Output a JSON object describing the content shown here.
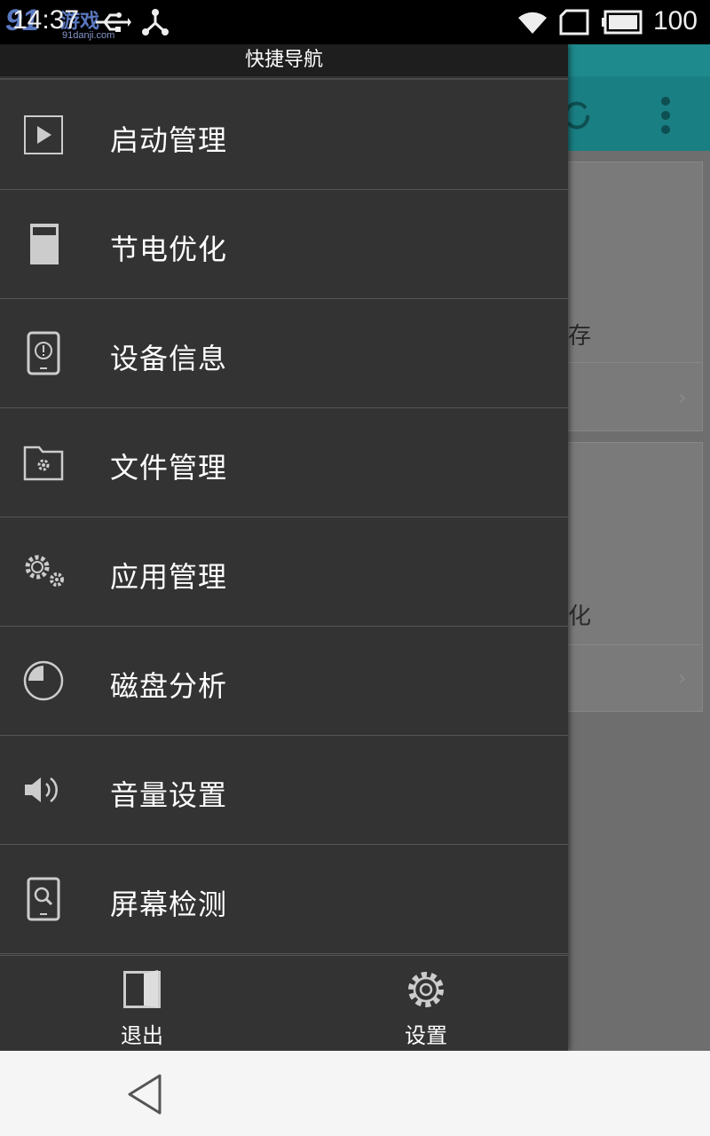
{
  "status_bar": {
    "time": "14:37",
    "watermark_logo": "91",
    "watermark_text": "游戏",
    "watermark_site": "91danji.com",
    "battery_level": "100",
    "icons": [
      "usb-icon",
      "share-icon",
      "wifi-icon",
      "sim-icon",
      "battery-icon"
    ]
  },
  "background_app": {
    "card1_text": "存",
    "card2_text": "化"
  },
  "drawer": {
    "title": "快捷导航",
    "items": [
      {
        "label": "启动管理",
        "icon": "play-icon"
      },
      {
        "label": "节电优化",
        "icon": "battery-icon"
      },
      {
        "label": "设备信息",
        "icon": "device-info-icon"
      },
      {
        "label": "文件管理",
        "icon": "folder-gear-icon"
      },
      {
        "label": "应用管理",
        "icon": "gears-icon"
      },
      {
        "label": "磁盘分析",
        "icon": "pie-chart-icon"
      },
      {
        "label": "音量设置",
        "icon": "speaker-icon"
      },
      {
        "label": "屏幕检测",
        "icon": "screen-search-icon"
      }
    ],
    "footer": {
      "exit_label": "退出",
      "settings_label": "设置"
    }
  },
  "colors": {
    "drawer_bg": "#333333",
    "header_bg": "#1e1e1e",
    "accent_teal": "#1e8a8e"
  }
}
